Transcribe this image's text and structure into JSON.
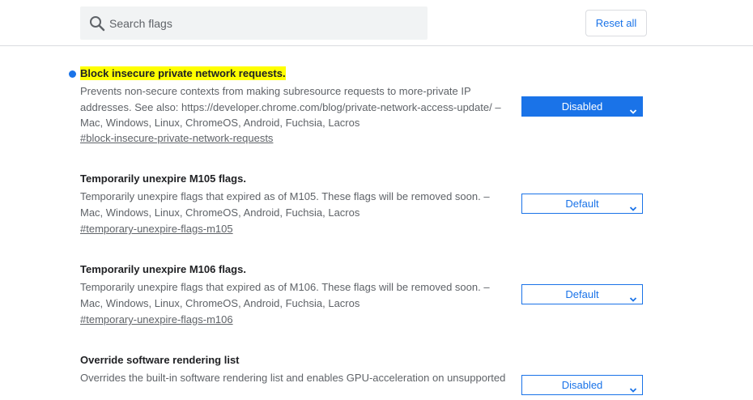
{
  "search": {
    "placeholder": "Search flags",
    "icon": "search-icon"
  },
  "header": {
    "reset_label": "Reset all"
  },
  "colors": {
    "accent": "#1a73e8",
    "highlight": "#ffff00",
    "secondary_text": "#5f6368"
  },
  "flags": [
    {
      "title": "Block insecure private network requests.",
      "modified": true,
      "description_lines": [
        "Prevents non-secure contexts from making subresource requests to more-private IP",
        "addresses. See also: https://developer.chrome.com/blog/private-network-access-update/ –",
        "Mac, Windows, Linux, ChromeOS, Android, Fuchsia, Lacros"
      ],
      "anchor": "#block-insecure-private-network-requests",
      "selected": "Disabled"
    },
    {
      "title": "Temporarily unexpire M105 flags.",
      "modified": false,
      "description_lines": [
        "Temporarily unexpire flags that expired as of M105. These flags will be removed soon. –",
        "Mac, Windows, Linux, ChromeOS, Android, Fuchsia, Lacros"
      ],
      "anchor": "#temporary-unexpire-flags-m105",
      "selected": "Default"
    },
    {
      "title": "Temporarily unexpire M106 flags.",
      "modified": false,
      "description_lines": [
        "Temporarily unexpire flags that expired as of M106. These flags will be removed soon. –",
        "Mac, Windows, Linux, ChromeOS, Android, Fuchsia, Lacros"
      ],
      "anchor": "#temporary-unexpire-flags-m106",
      "selected": "Default"
    },
    {
      "title": "Override software rendering list",
      "modified": false,
      "description_lines": [
        "Overrides the built-in software rendering list and enables GPU-acceleration on unsupported"
      ],
      "anchor": "",
      "selected": "Disabled"
    }
  ]
}
